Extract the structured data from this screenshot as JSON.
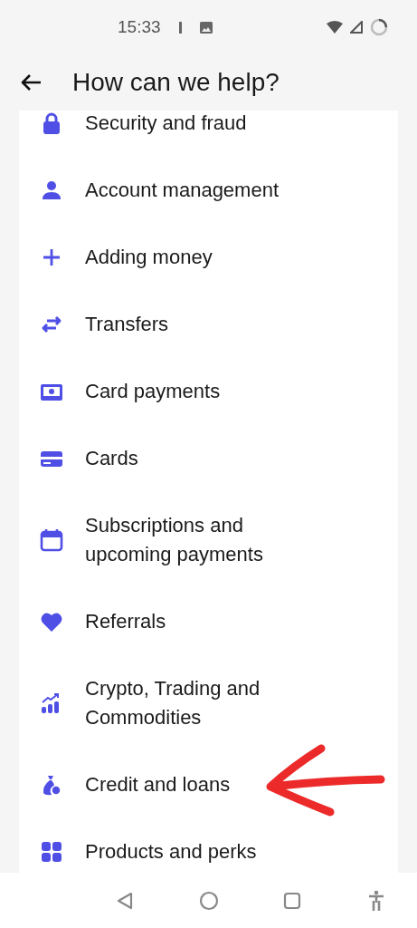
{
  "status_bar": {
    "time": "15:33"
  },
  "header": {
    "title": "How can we help?"
  },
  "topics": [
    {
      "label": "Security and fraud"
    },
    {
      "label": "Account management"
    },
    {
      "label": "Adding money"
    },
    {
      "label": "Transfers"
    },
    {
      "label": "Card payments"
    },
    {
      "label": "Cards"
    },
    {
      "label": "Subscriptions and upcoming payments"
    },
    {
      "label": "Referrals"
    },
    {
      "label": "Crypto, Trading and Commodities"
    },
    {
      "label": "Credit and loans"
    },
    {
      "label": "Products and perks"
    }
  ]
}
